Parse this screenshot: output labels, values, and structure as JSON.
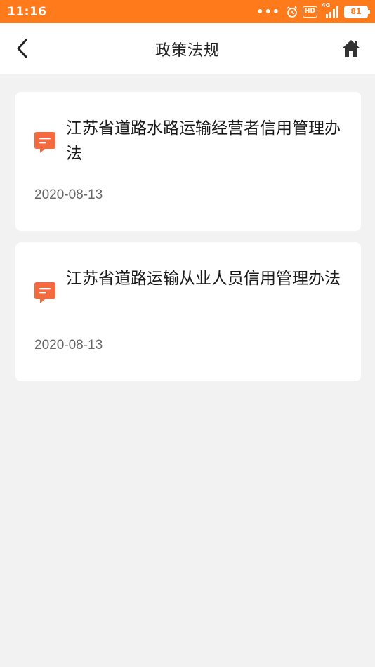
{
  "status_bar": {
    "time": "11:16",
    "network": "4G",
    "hd": "HD",
    "battery": "81"
  },
  "nav": {
    "title": "政策法规",
    "back_icon": "chevron-left-icon",
    "home_icon": "home-icon"
  },
  "policies": [
    {
      "title": "江苏省道路水路运输经营者信用管理办法",
      "date": "2020-08-13",
      "icon": "message-icon"
    },
    {
      "title": "江苏省道路运输从业人员信用管理办法",
      "date": "2020-08-13",
      "icon": "message-icon"
    }
  ],
  "colors": {
    "status_bar": "#ff7a1a",
    "icon_accent": "#f26a3d",
    "background": "#f2f2f2"
  }
}
